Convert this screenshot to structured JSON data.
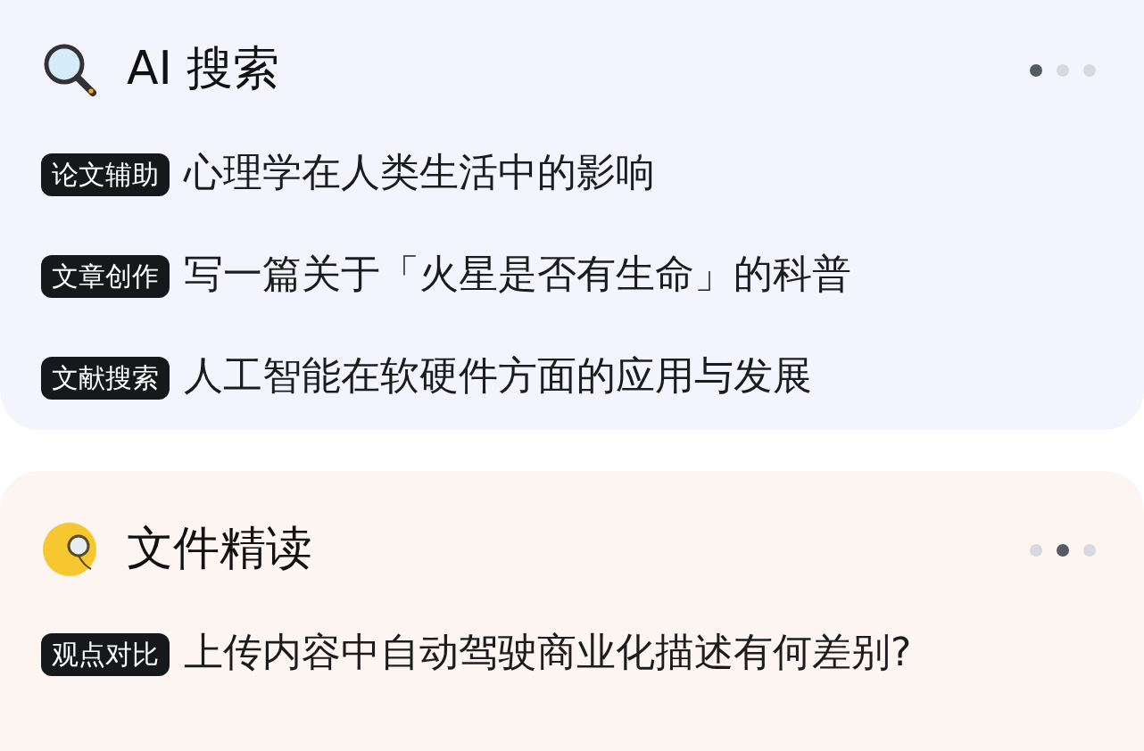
{
  "cards": [
    {
      "kind": "search",
      "title": "AI 搜索",
      "dots": [
        {
          "selected": true
        },
        {
          "selected": false
        },
        {
          "selected": false
        }
      ],
      "items": [
        {
          "tag": "论文辅助",
          "text": "心理学在人类生活中的影响"
        },
        {
          "tag": "文章创作",
          "text": "写一篇关于「火星是否有生命」的科普"
        },
        {
          "tag": "文献搜索",
          "text": "人工智能在软硬件方面的应用与发展"
        }
      ]
    },
    {
      "kind": "reading",
      "title": "文件精读",
      "dots": [
        {
          "selected": false
        },
        {
          "selected": true
        },
        {
          "selected": false
        }
      ],
      "items": [
        {
          "tag": "观点对比",
          "text": "上传内容中自动驾驶商业化描述有何差别?"
        }
      ]
    }
  ]
}
